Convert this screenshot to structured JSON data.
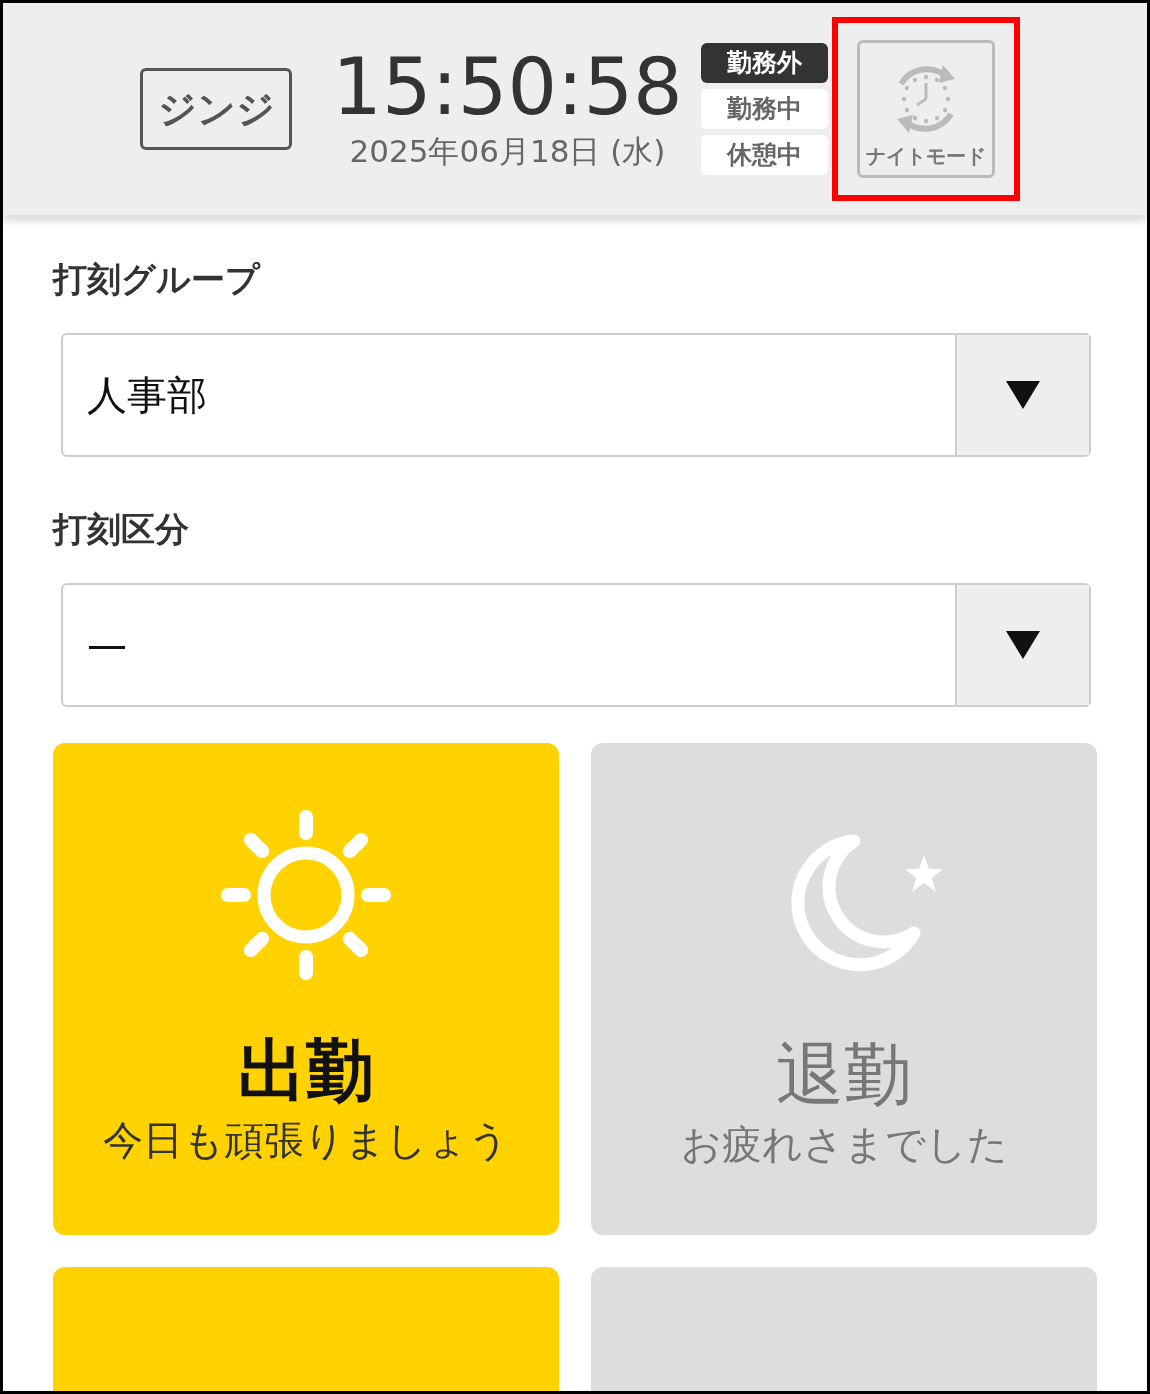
{
  "header": {
    "logo": "ジンジ",
    "time": "15:50:58",
    "date": "2025年06月18日 (水)",
    "statuses": [
      {
        "label": "勤務外",
        "selected": true
      },
      {
        "label": "勤務中",
        "selected": false
      },
      {
        "label": "休憩中",
        "selected": false
      }
    ],
    "night_mode": {
      "label": "ナイトモード",
      "highlighted": true
    }
  },
  "fields": [
    {
      "label": "打刻グループ",
      "value": "人事部"
    },
    {
      "label": "打刻区分",
      "value": "—"
    }
  ],
  "tiles": [
    {
      "kind": "sun",
      "active": true,
      "title": "出勤",
      "subtitle": "今日も頑張りましょう"
    },
    {
      "kind": "moon",
      "active": false,
      "title": "退勤",
      "subtitle": "お疲れさまでした"
    },
    {
      "kind": "blank",
      "active": true
    },
    {
      "kind": "blank",
      "active": false
    }
  ]
}
